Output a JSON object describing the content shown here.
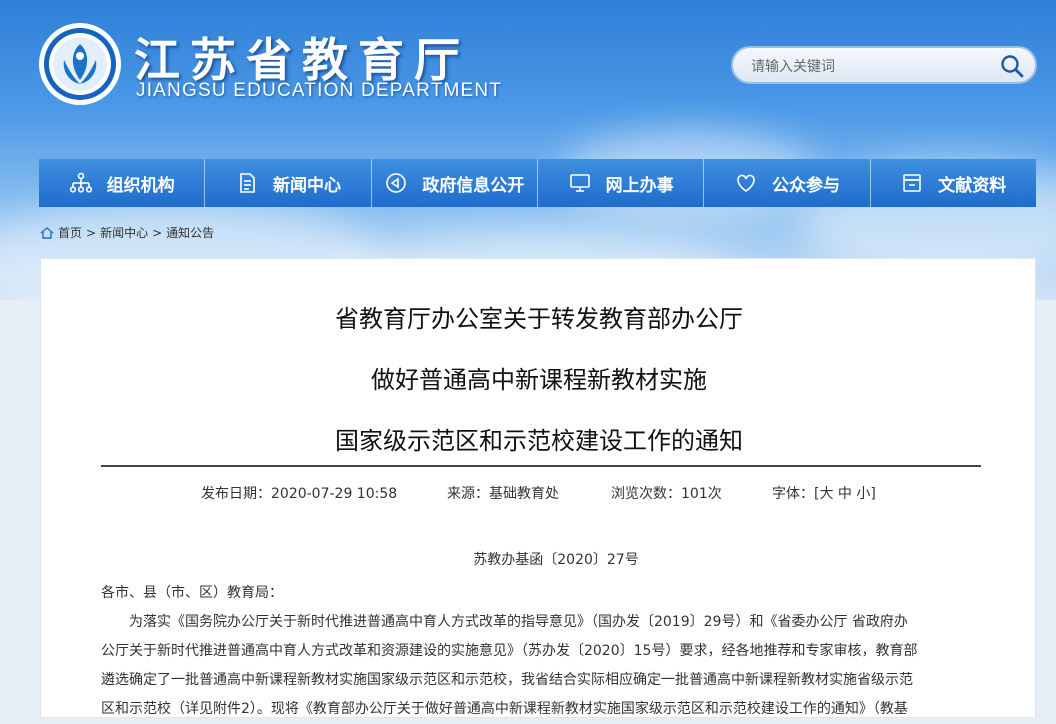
{
  "header": {
    "title_cn": "江苏省教育厅",
    "title_en": "JIANGSU EDUCATION DEPARTMENT",
    "search_placeholder": "请输入关键词"
  },
  "nav": [
    {
      "label": "组织机构",
      "icon": "org-chart-icon"
    },
    {
      "label": "新闻中心",
      "icon": "document-icon"
    },
    {
      "label": "政府信息公开",
      "icon": "announce-icon"
    },
    {
      "label": "网上办事",
      "icon": "monitor-icon"
    },
    {
      "label": "公众参与",
      "icon": "heart-icon"
    },
    {
      "label": "文献资料",
      "icon": "archive-icon"
    }
  ],
  "breadcrumb": {
    "home": "首页",
    "sep": ">",
    "news": "新闻中心",
    "notice": "通知公告"
  },
  "article": {
    "title_lines": [
      "省教育厅办公室关于转发教育部办公厅",
      "做好普通高中新课程新教材实施",
      "国家级示范区和示范校建设工作的通知"
    ],
    "meta": {
      "date_label": "发布日期：2020-07-29 10:58",
      "source_label": "来源：基础教育处",
      "views_label": "浏览次数：101次",
      "font_label": "字体：[大 中 小]"
    },
    "doc_no": "苏教办基函〔2020〕27号",
    "salutation": "各市、县（市、区）教育局：",
    "para_lines": [
      "　　为落实《国务院办公厅关于新时代推进普通高中育人方式改革的指导意见》（国办发〔2019〕29号）和《省委办公厅 省政府办",
      "公厅关于新时代推进普通高中育人方式改革和资源建设的实施意见》（苏办发〔2020〕15号）要求，经各地推荐和专家审核，教育部",
      "遴选确定了一批普通高中新课程新教材实施国家级示范区和示范校，我省结合实际相应确定一批普通高中新课程新教材实施省级示范",
      "区和示范校（详见附件2）。现将《教育部办公厅关于做好普通高中新课程新教材实施国家级示范区和示范校建设工作的通知》（教基"
    ]
  },
  "colors": {
    "nav": "#1f6ccc",
    "sky": "#3a88dc"
  }
}
